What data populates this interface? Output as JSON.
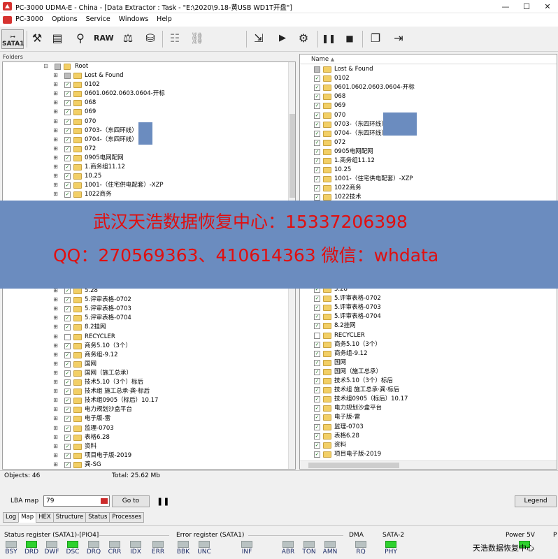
{
  "window": {
    "title": "PC-3000 UDMA-E - China - [Data Extractor : Task - \"E:\\2020\\9.18-黄USB WD1T开盘\"]",
    "min": "—",
    "max": "☐",
    "close": "✕"
  },
  "menu": {
    "items": [
      "PC-3000",
      "Options",
      "Service",
      "Windows",
      "Help"
    ]
  },
  "toolbar": {
    "sata_label": "SATA1",
    "raw_label": "RAW"
  },
  "folders_header": "Folders",
  "left_tree": {
    "root": "Root",
    "items_top": [
      "Lost & Found",
      "0102",
      "0601.0602.0603.0604-开标",
      "068",
      "069",
      "070",
      "0703-（东四环线）",
      "0704-（东四环线）",
      "072",
      "0905电网配网",
      "1.商务组11.12",
      "10.25",
      "1001-（住宅供电配套）-XZP",
      "1022商务"
    ],
    "items_bottom": [
      "5.28",
      "5.评审表格-0702",
      "5.评审表格-0703",
      "5.评审表格-0704",
      "8.2挂网",
      "RECYCLER",
      "商务5.10（3个）",
      "商务组-9.12",
      "国网",
      "国网（施工总承）",
      "技术5.10（3个）标后",
      "技术组 施工总承·龚·标后",
      "技术组0905（标后）10.17",
      "电力规划沙盒平台",
      "电子版-雷",
      "监理-0703",
      "表格6.28",
      "资料",
      "项目电子版-2019",
      "龚-SG"
    ]
  },
  "right_list": {
    "header": "Name",
    "items_top": [
      "Lost & Found",
      "0102",
      "0601.0602.0603.0604-开标",
      "068",
      "069",
      "070",
      "0703-（东四环线）",
      "0704-（东四环线）",
      "072",
      "0905电网配网",
      "1.商务组11.12",
      "10.25",
      "1001-（住宅供电配套）-XZP",
      "1022商务",
      "1022技术"
    ],
    "items_bottom": [
      "5.28",
      "5.评审表格-0702",
      "5.评审表格-0703",
      "5.评审表格-0704",
      "8.2挂网",
      "RECYCLER",
      "商务5.10（3个）",
      "商务组-9.12",
      "国网",
      "国网（施工总承）",
      "技术5.10（3个）标后",
      "技术组 施工总承·龚·标后",
      "技术组0905（标后）10.17",
      "电力规划沙盒平台",
      "电子版-雷",
      "监理-0703",
      "表格6.28",
      "资料",
      "项目电子版-2019"
    ]
  },
  "banner": {
    "line1": "武汉天浩数据恢复中心：15337206398",
    "line2": "QQ：270569363、410614363   微信：whdata"
  },
  "status": {
    "objects": "Objects: 46",
    "total": "Total: 25.62 Mb"
  },
  "lba": {
    "label": "LBA map",
    "value": "79",
    "goto": "Go to",
    "legend": "Legend"
  },
  "tabs": [
    "Log",
    "Map",
    "HEX",
    "Structure",
    "Status",
    "Processes"
  ],
  "registers": {
    "status_title": "Status register (SATA1)-[PIO4]",
    "status_leds": [
      "BSY",
      "DRD",
      "DWF",
      "DSC",
      "DRQ",
      "CRR",
      "IDX",
      "ERR"
    ],
    "error_title": "Error register (SATA1)",
    "error_leds": [
      "BBK",
      "UNC",
      "INF",
      "ABR",
      "TON",
      "AMN"
    ],
    "dma_title": "DMA",
    "dma_led": "RQ",
    "sata2_title": "SATA-2",
    "sata2_led": "PHY",
    "power_title": "Power 5V",
    "extra_title": "P"
  },
  "watermark": "天浩数据恢复中心"
}
